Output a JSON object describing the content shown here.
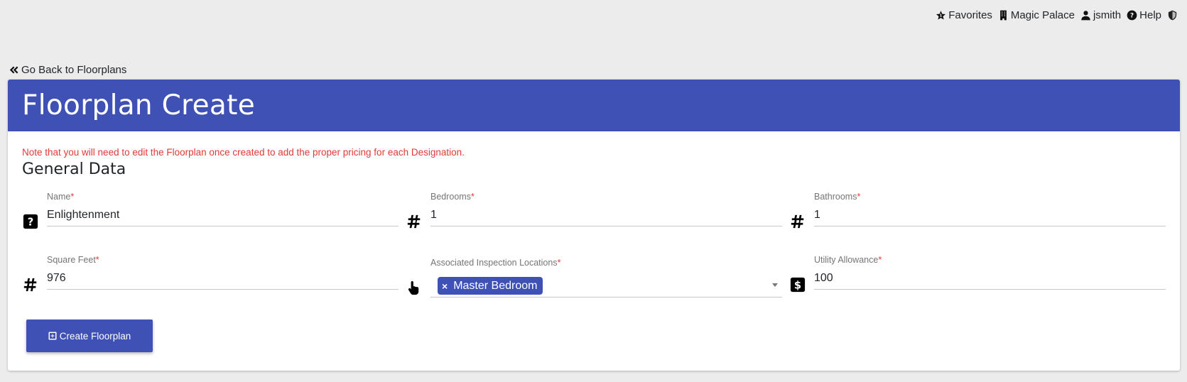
{
  "topnav": {
    "items": [
      {
        "label": "Favorites",
        "icon": "star-icon"
      },
      {
        "label": "Magic Palace",
        "icon": "building-icon"
      },
      {
        "label": "jsmith",
        "icon": "user-icon"
      },
      {
        "label": "Help",
        "icon": "question-circle-icon"
      }
    ],
    "shield_icon": "shield-icon"
  },
  "back_link": {
    "label": "Go Back to Floorplans",
    "icon": "double-chevron-left-icon"
  },
  "card": {
    "title": "Floorplan Create",
    "note": "Note that you will need to edit the Floorplan once created to add the proper pricing for each Designation.",
    "section_title": "General Data"
  },
  "fields": {
    "name": {
      "label": "Name",
      "required": "*",
      "value": "Enlightenment",
      "icon": "question-square-icon"
    },
    "bedrooms": {
      "label": "Bedrooms",
      "required": "*",
      "value": "1",
      "icon": "hashtag-icon"
    },
    "bathrooms": {
      "label": "Bathrooms",
      "required": "*",
      "value": "1",
      "icon": "hashtag-icon"
    },
    "square_feet": {
      "label": "Square Feet",
      "required": "*",
      "value": "976",
      "icon": "hashtag-icon"
    },
    "locations": {
      "label": "Associated Inspection Locations",
      "required": "*",
      "selected": "Master Bedroom",
      "remove": "×",
      "icon": "hand-pointer-icon"
    },
    "utility": {
      "label": "Utility Allowance",
      "required": "*",
      "value": "100",
      "icon": "dollar-square-icon"
    }
  },
  "create_button": {
    "label": "Create Floorplan",
    "icon": "plus-square-icon"
  },
  "colors": {
    "primary": "#3f51b5",
    "note": "#e53935",
    "background": "#ececec"
  }
}
